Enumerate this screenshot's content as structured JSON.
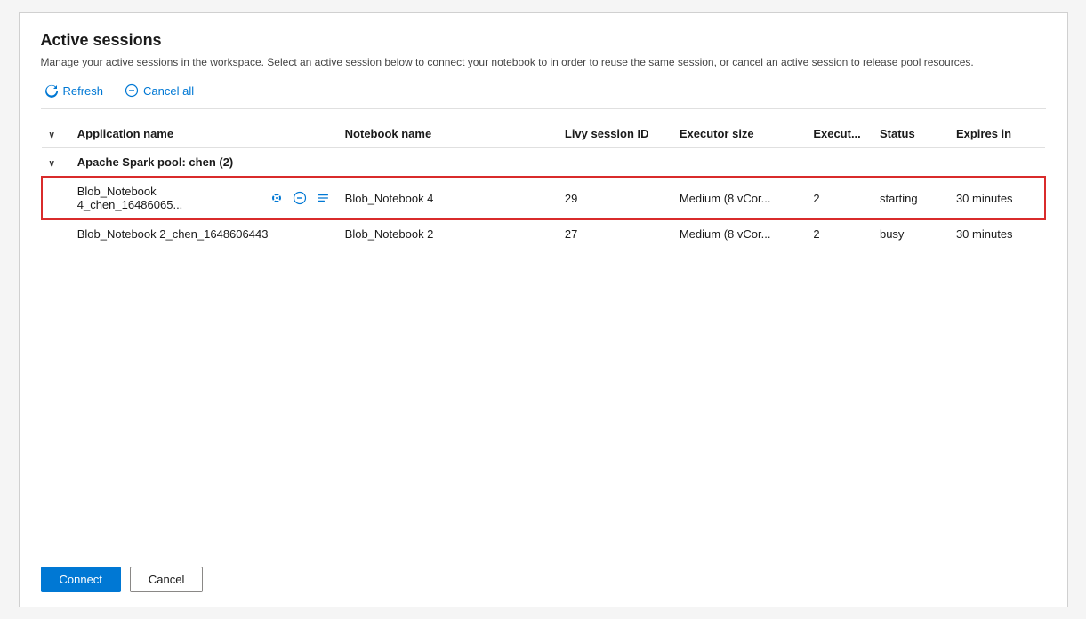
{
  "dialog": {
    "title": "Active sessions",
    "subtitle": "Manage your active sessions in the workspace. Select an active session below to connect your notebook to in order to reuse the same session, or cancel an active session to release pool resources.",
    "toolbar": {
      "refresh_label": "Refresh",
      "cancel_all_label": "Cancel all"
    },
    "table": {
      "columns": [
        {
          "key": "chevron",
          "label": ""
        },
        {
          "key": "appname",
          "label": "Application name"
        },
        {
          "key": "notebook",
          "label": "Notebook name"
        },
        {
          "key": "livy",
          "label": "Livy session ID"
        },
        {
          "key": "executor_size",
          "label": "Executor size"
        },
        {
          "key": "exec_count",
          "label": "Execut..."
        },
        {
          "key": "status",
          "label": "Status"
        },
        {
          "key": "expires",
          "label": "Expires in"
        }
      ],
      "group": {
        "label": "Apache Spark pool: chen (2)"
      },
      "rows": [
        {
          "id": "row1",
          "appname": "Blob_Notebook 4_chen_16486065...",
          "notebook": "Blob_Notebook 4",
          "livy": "29",
          "executor_size": "Medium (8 vCor...",
          "exec_count": "2",
          "status": "starting",
          "expires": "30 minutes",
          "selected": true
        },
        {
          "id": "row2",
          "appname": "Blob_Notebook 2_chen_1648606443",
          "notebook": "Blob_Notebook 2",
          "livy": "27",
          "executor_size": "Medium (8 vCor...",
          "exec_count": "2",
          "status": "busy",
          "expires": "30 minutes",
          "selected": false
        }
      ]
    },
    "footer": {
      "connect_label": "Connect",
      "cancel_label": "Cancel"
    }
  }
}
